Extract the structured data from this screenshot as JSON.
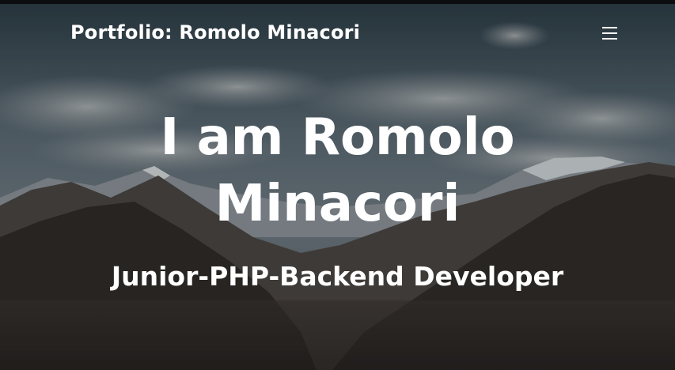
{
  "navbar": {
    "brand": "Portfolio: Romolo Minacori",
    "menu_icon": "hamburger-menu-icon"
  },
  "hero": {
    "headline_line1": "I am Romolo",
    "headline_line2": "Minacori",
    "subtitle": "Junior-PHP-Backend Developer",
    "background": "mountain-landscape"
  },
  "colors": {
    "text": "#ffffff",
    "sky": "#5c6a75",
    "mountain_dark": "#2b2623"
  }
}
